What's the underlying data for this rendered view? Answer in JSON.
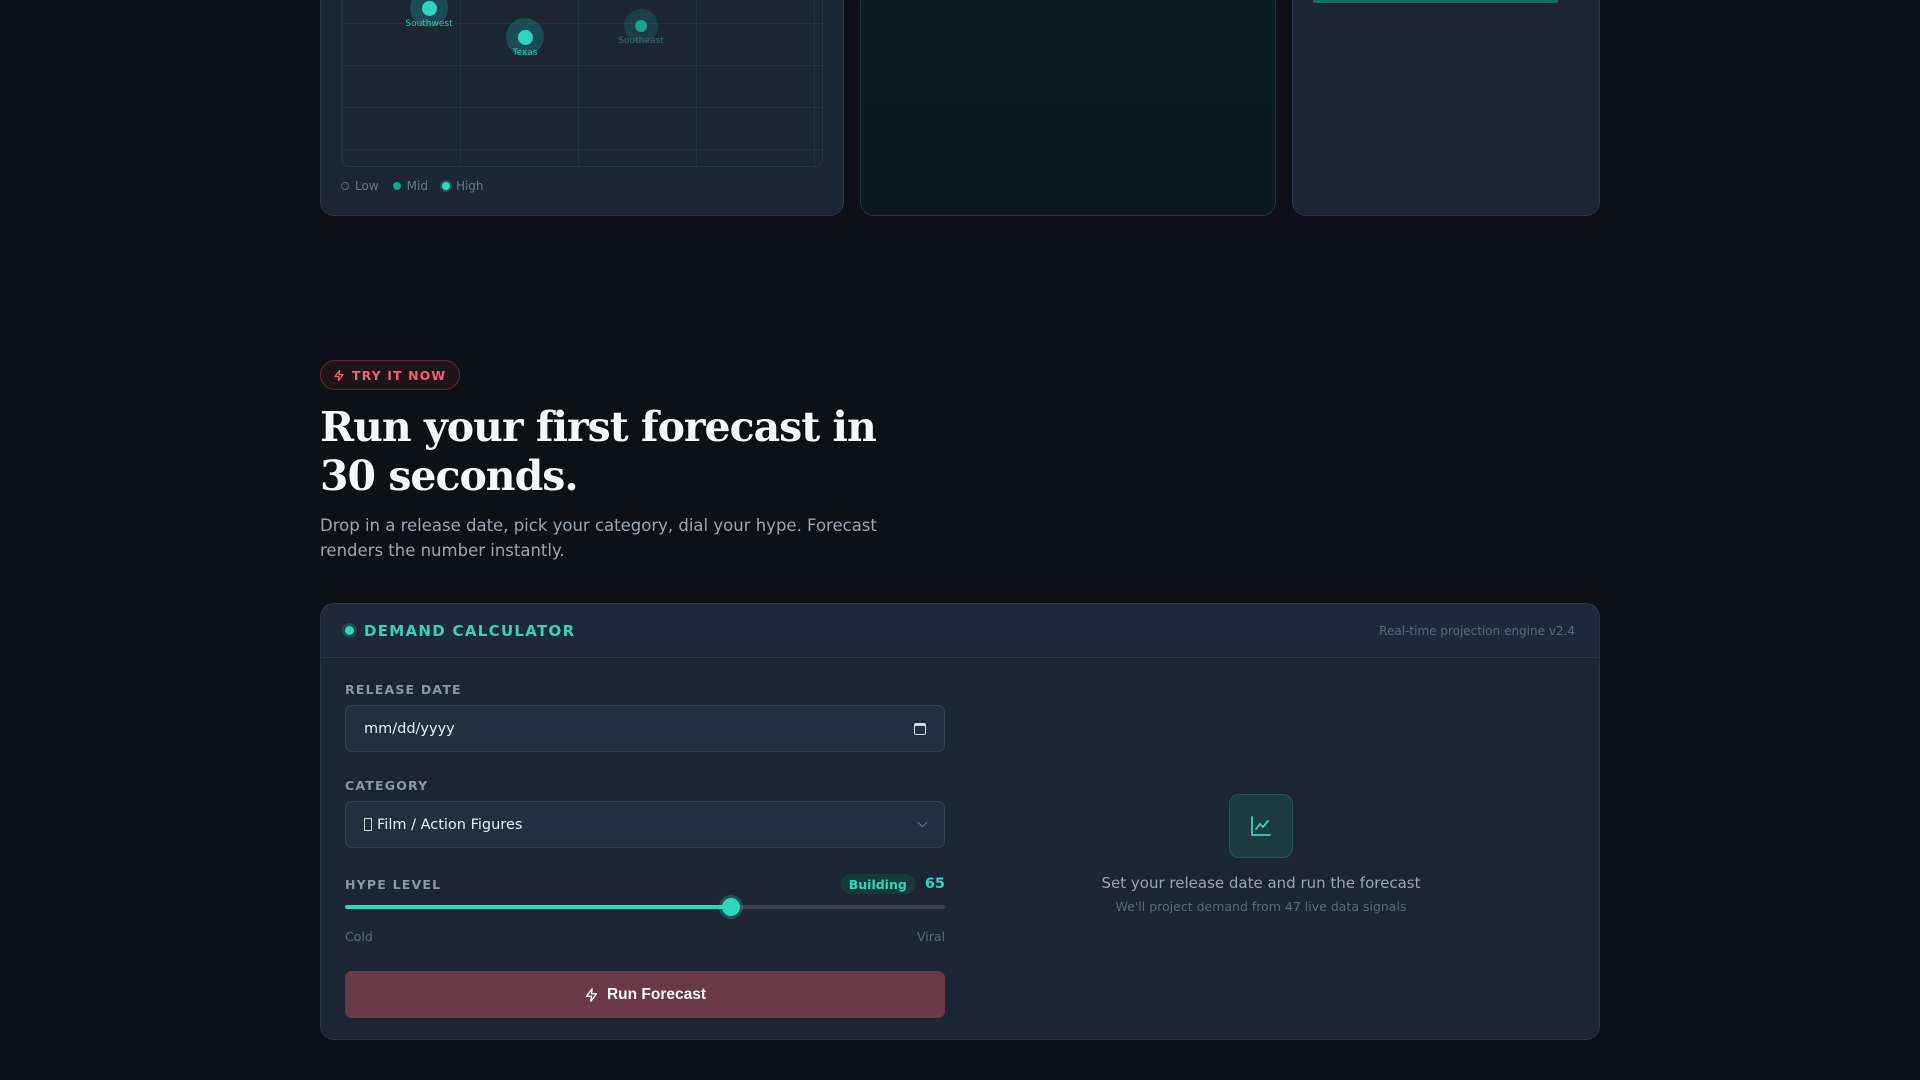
{
  "map": {
    "nodes": [
      {
        "label": "Southwest",
        "level": "high"
      },
      {
        "label": "Texas",
        "level": "high"
      },
      {
        "label": "Southeast",
        "level": "mid"
      }
    ],
    "legend": [
      "Low",
      "Mid",
      "High"
    ]
  },
  "hero": {
    "pill_label": "TRY IT NOW",
    "headline": "Run your first forecast in 30 seconds.",
    "subtext": "Drop in a release date, pick your category, dial your hype. Forecast renders the number instantly."
  },
  "calculator": {
    "title": "DEMAND CALCULATOR",
    "engine": "Real-time projection engine v2.4",
    "release_date_label": "RELEASE DATE",
    "release_date_placeholder": "mm/dd/yyyy",
    "category_label": "CATEGORY",
    "category_value": "Film / Action Figures",
    "hype_label": "HYPE LEVEL",
    "hype_badge": "Building",
    "hype_value": "65",
    "hype_fraction": 0.643,
    "hype_min_label": "Cold",
    "hype_max_label": "Viral",
    "run_button": "Run Forecast",
    "result_main": "Set your release date and run the forecast",
    "result_sub": "We'll project demand from 47 live data signals"
  },
  "colors": {
    "accent": "#2fd6bd",
    "danger": "#f0626f",
    "button_bg": "#6a3947",
    "background": "#0d1017",
    "card": "#1c2534"
  },
  "icons": [
    "bolt-icon",
    "calendar-icon",
    "chevron-down-icon",
    "line-chart-icon"
  ]
}
